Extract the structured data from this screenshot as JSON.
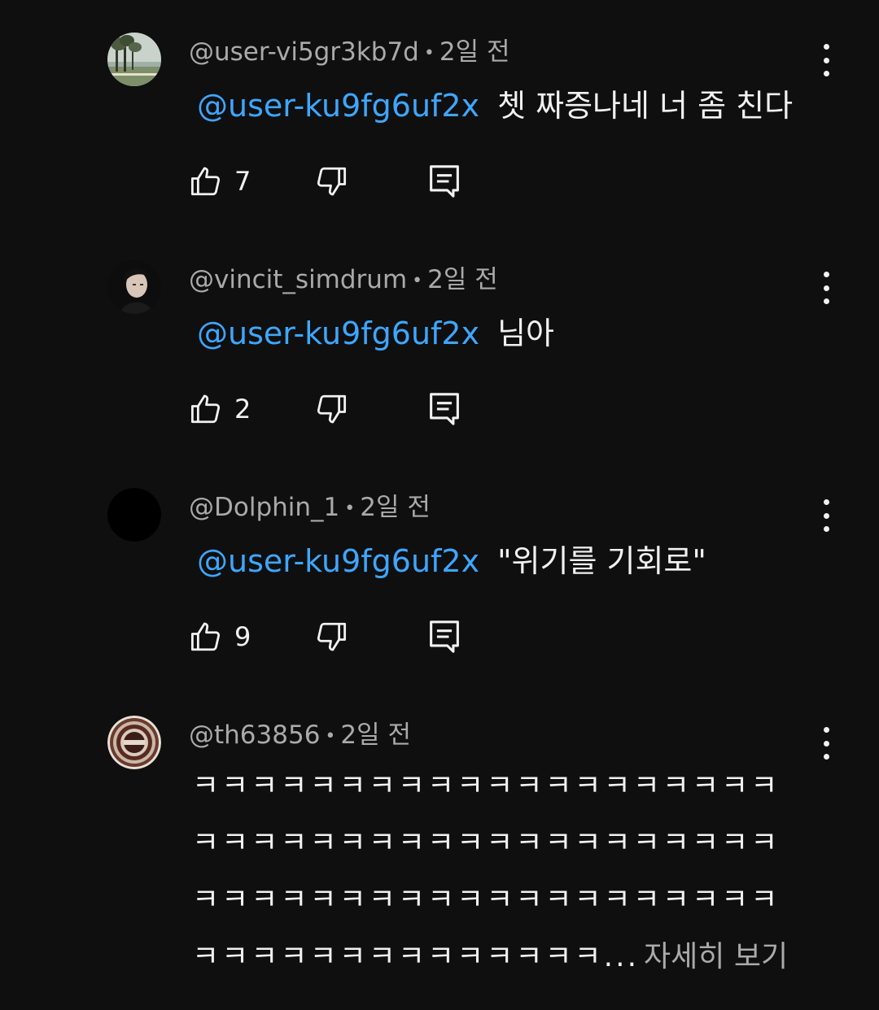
{
  "comments": [
    {
      "author": "@user-vi5gr3kb7d",
      "time": "2일 전",
      "mention": "@user-ku9fg6uf2x",
      "text": "쳇 짜증나네 너 좀 친다",
      "likes": "7",
      "avatar": "landscape-trees"
    },
    {
      "author": "@vincit_simdrum",
      "time": "2일 전",
      "mention": "@user-ku9fg6uf2x",
      "text": "님아",
      "likes": "2",
      "avatar": "person-dark"
    },
    {
      "author": "@Dolphin_1",
      "time": "2일 전",
      "mention": "@user-ku9fg6uf2x",
      "text": "\"위기를 기회로\"",
      "likes": "9",
      "avatar": "black-circle"
    },
    {
      "author": "@th63856",
      "time": "2일 전",
      "lines": [
        "ㅋㅋㅋㅋㅋㅋㅋㅋㅋㅋㅋㅋㅋㅋㅋㅋㅋㅋㅋㅋ",
        "ㅋㅋㅋㅋㅋㅋㅋㅋㅋㅋㅋㅋㅋㅋㅋㅋㅋㅋㅋㅋ",
        "ㅋㅋㅋㅋㅋㅋㅋㅋㅋㅋㅋㅋㅋㅋㅋㅋㅋㅋㅋㅋ",
        "ㅋㅋㅋㅋㅋㅋㅋㅋㅋㅋㅋㅋㅋㅋ..."
      ],
      "read_more": "자세히 보기",
      "avatar": "ornate-emblem"
    }
  ],
  "icons": {
    "like": "thumbs-up-icon",
    "dislike": "thumbs-down-icon",
    "reply": "reply-icon",
    "menu": "more-vert-icon"
  },
  "colors": {
    "background": "#0f0f0f",
    "text": "#f1f1f1",
    "secondary": "#aaaaaa",
    "mention": "#3ea6ff"
  }
}
